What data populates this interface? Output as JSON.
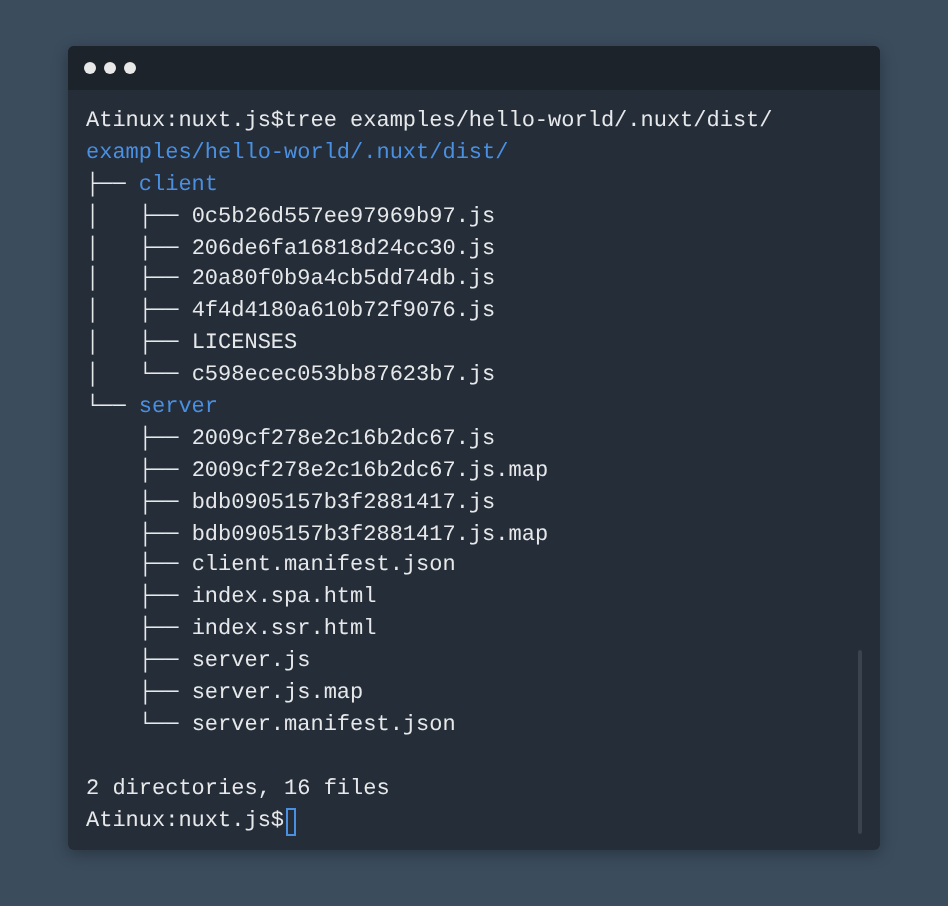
{
  "terminal": {
    "lines": [
      {
        "kind": "command",
        "prompt": "Atinux:nuxt.js$",
        "text": "tree examples/hello-world/.nuxt/dist/"
      },
      {
        "kind": "dir",
        "name": "examples/hello-world/.nuxt/dist/"
      },
      {
        "kind": "dir",
        "prefix": "├── ",
        "name": "client"
      },
      {
        "kind": "file",
        "prefix": "│   ├── ",
        "name": "0c5b26d557ee97969b97.js"
      },
      {
        "kind": "file",
        "prefix": "│   ├── ",
        "name": "206de6fa16818d24cc30.js"
      },
      {
        "kind": "file",
        "prefix": "│   ├── ",
        "name": "20a80f0b9a4cb5dd74db.js"
      },
      {
        "kind": "file",
        "prefix": "│   ├── ",
        "name": "4f4d4180a610b72f9076.js"
      },
      {
        "kind": "file",
        "prefix": "│   ├── ",
        "name": "LICENSES"
      },
      {
        "kind": "file",
        "prefix": "│   └── ",
        "name": "c598ecec053bb87623b7.js"
      },
      {
        "kind": "dir",
        "prefix": "└── ",
        "name": "server"
      },
      {
        "kind": "file",
        "prefix": "    ├── ",
        "name": "2009cf278e2c16b2dc67.js"
      },
      {
        "kind": "file",
        "prefix": "    ├── ",
        "name": "2009cf278e2c16b2dc67.js.map"
      },
      {
        "kind": "file",
        "prefix": "    ├── ",
        "name": "bdb0905157b3f2881417.js"
      },
      {
        "kind": "file",
        "prefix": "    ├── ",
        "name": "bdb0905157b3f2881417.js.map"
      },
      {
        "kind": "file",
        "prefix": "    ├── ",
        "name": "client.manifest.json"
      },
      {
        "kind": "file",
        "prefix": "    ├── ",
        "name": "index.spa.html"
      },
      {
        "kind": "file",
        "prefix": "    ├── ",
        "name": "index.ssr.html"
      },
      {
        "kind": "file",
        "prefix": "    ├── ",
        "name": "server.js"
      },
      {
        "kind": "file",
        "prefix": "    ├── ",
        "name": "server.js.map"
      },
      {
        "kind": "file",
        "prefix": "    └── ",
        "name": "server.manifest.json"
      },
      {
        "kind": "blank"
      },
      {
        "kind": "summary",
        "text": "2 directories, 16 files"
      },
      {
        "kind": "input",
        "prompt": "Atinux:nuxt.js$"
      }
    ]
  }
}
